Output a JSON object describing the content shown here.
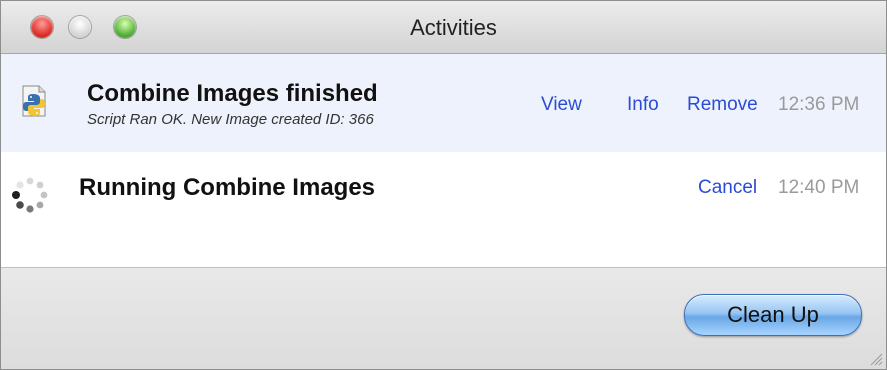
{
  "window": {
    "title": "Activities"
  },
  "activities": [
    {
      "icon": "python-script-icon",
      "title": "Combine Images finished",
      "subtitle": "Script Ran OK. New Image created ID: 366",
      "actions": {
        "view": "View",
        "info": "Info",
        "remove": "Remove"
      },
      "time": "12:36 PM"
    },
    {
      "icon": "spinner-icon",
      "title": "Running Combine Images",
      "actions": {
        "cancel": "Cancel"
      },
      "time": "12:40 PM"
    }
  ],
  "footer": {
    "cleanup_label": "Clean Up"
  },
  "colors": {
    "link": "#2b4bd6",
    "selected_row": "#eef2fc",
    "time": "#9a9a9a"
  }
}
